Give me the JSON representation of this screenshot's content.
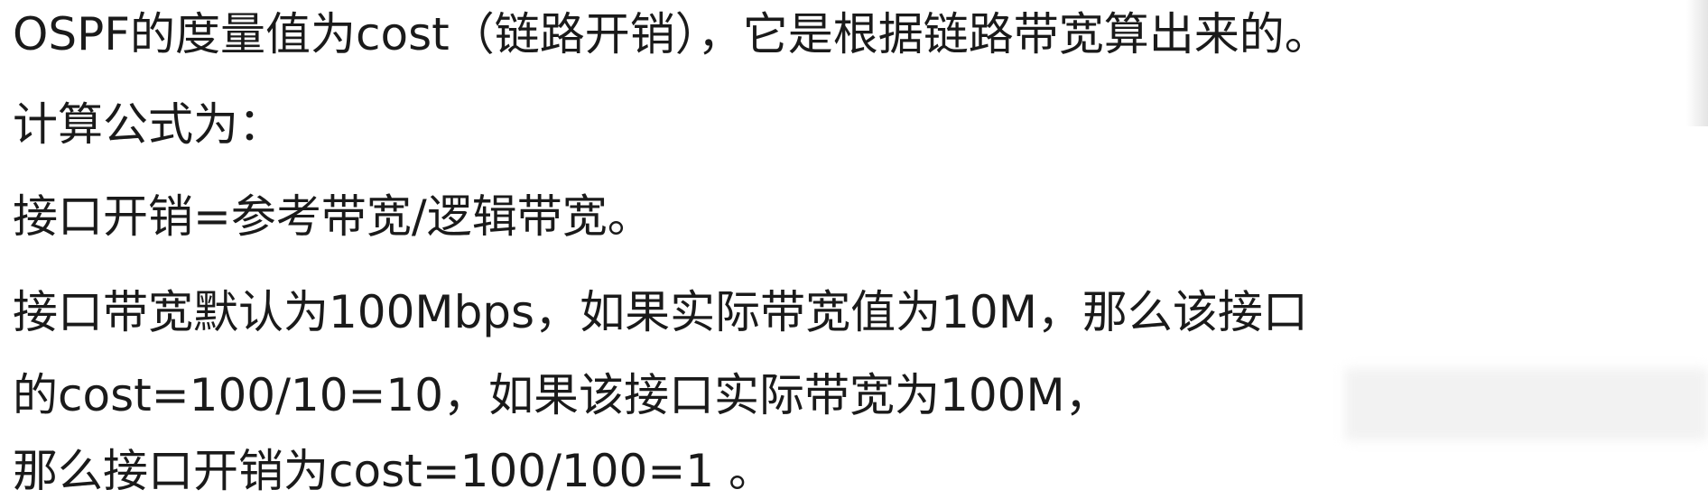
{
  "slide": {
    "lines": [
      "OSPF的度量值为cost（链路开销），它是根据链路带宽算出来的。",
      "计算公式为：",
      "接口开销=参考带宽/逻辑带宽。",
      "接口带宽默认为100Mbps，如果实际带宽值为10M，那么该接口",
      "的cost=100/10=10，如果该接口实际带宽为100M，",
      "那么接口开销为cost=100/100=1 。"
    ]
  }
}
